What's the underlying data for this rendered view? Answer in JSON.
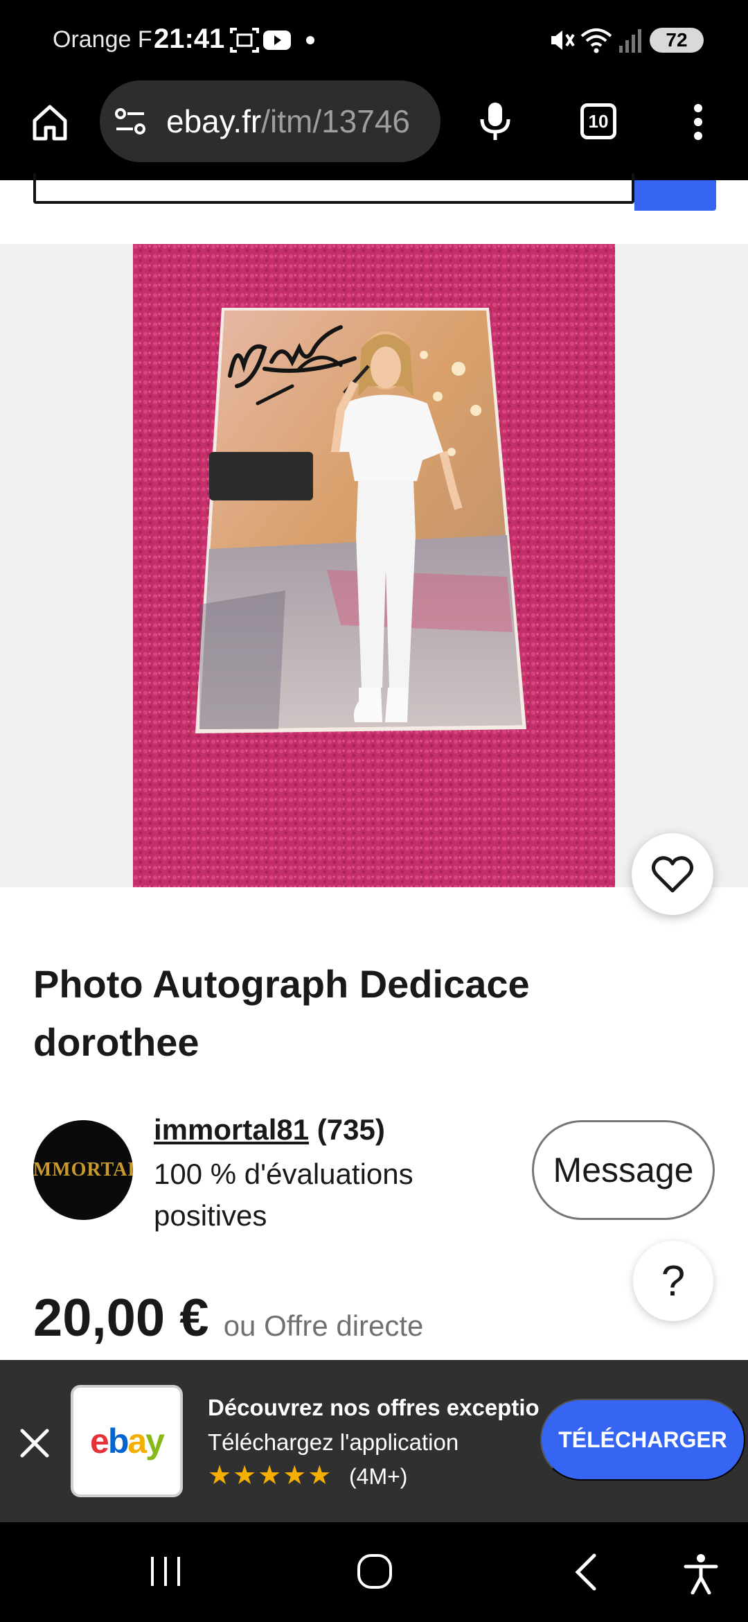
{
  "status_bar": {
    "carrier": "Orange F",
    "time": "21:41",
    "battery": "72"
  },
  "browser": {
    "url_host": "ebay.fr",
    "url_path": "/itm/13746",
    "tab_count": "10"
  },
  "listing": {
    "title": "Photo Autograph Dedicace dorothee",
    "seller": {
      "avatar_text": "IMMORTAL",
      "name": "immortal81",
      "feedback_count": "(735)",
      "positive_text": "100 % d'évaluations positives"
    },
    "message_button": "Message",
    "help_button": "?",
    "price": "20,00 €",
    "price_offer": "ou Offre directe"
  },
  "app_banner": {
    "title": "Découvrez nos offres exceptio...",
    "subtitle": "Téléchargez l'application",
    "stars": "★★★★★",
    "rating_count": "(4M+)",
    "download_button": "TÉLÉCHARGER",
    "logo_letters": [
      "e",
      "b",
      "a",
      "y"
    ]
  },
  "colors": {
    "ebay_blue": "#3665f3",
    "towel_pink": "#c42f6a",
    "banner_bg": "#303030"
  },
  "icons": [
    "home-icon",
    "site-settings-icon",
    "microphone-icon",
    "tabs-icon",
    "more-menu-icon",
    "heart-icon",
    "close-icon",
    "recent-apps-icon",
    "home-nav-icon",
    "back-icon",
    "accessibility-icon",
    "mute-icon",
    "wifi-icon",
    "signal-icon",
    "screenshot-icon",
    "youtube-icon"
  ]
}
